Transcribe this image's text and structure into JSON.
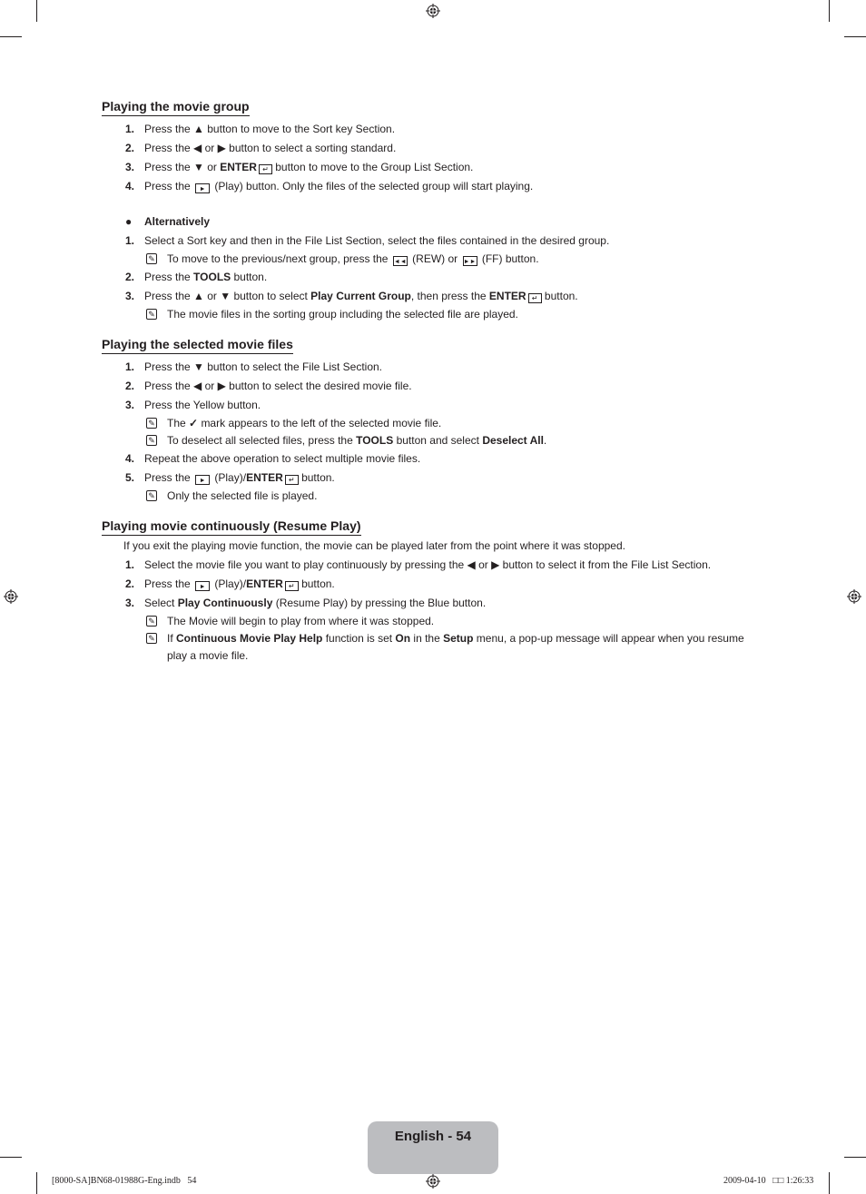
{
  "sections": [
    {
      "title": "Playing the movie group",
      "steps": [
        {
          "num": "1.",
          "parts": [
            "Press the ",
            "▲",
            " button to move to the Sort key Section."
          ]
        },
        {
          "num": "2.",
          "parts": [
            "Press the ",
            "◀ or ▶",
            " button to select a sorting standard."
          ]
        },
        {
          "num": "3.",
          "pre": "Press the ▼ or ",
          "bold": "ENTER",
          "post": " button to move to the Group List Section."
        },
        {
          "num": "4.",
          "pre": "Press the",
          "post": "(Play) button. Only the files of the selected group will start playing."
        }
      ],
      "alternatively": {
        "label": "Alternatively",
        "step1": {
          "num": "1.",
          "text": "Select a Sort key and then in the File List Section, select the files contained in the desired group."
        },
        "note1": {
          "pre": "To move to the previous/next group, press the",
          "mid": "(REW) or",
          "post": "(FF) button."
        },
        "step2": {
          "num": "2.",
          "pre": "Press the ",
          "bold": "TOOLS",
          "post": " button."
        },
        "step3": {
          "num": "3.",
          "pre": "Press the ▲ or ▼ button to select ",
          "bold1": "Play Current Group",
          "mid": ", then press the ",
          "bold2": "ENTER",
          "post": " button."
        },
        "note3": "The movie files in the sorting group including the selected file are played."
      }
    },
    {
      "title": "Playing the selected movie files",
      "step1": {
        "num": "1.",
        "text": "Press the ▼ button to select the File List Section."
      },
      "step2": {
        "num": "2.",
        "text": "Press the ◀ or ▶ button to select the desired movie file."
      },
      "step3": {
        "num": "3.",
        "text": "Press the Yellow button."
      },
      "note3a": {
        "pre": "The",
        "post": "mark appears to the left of the selected movie file."
      },
      "note3b": {
        "pre": "To deselect all selected files, press the ",
        "bold1": "TOOLS",
        "mid": " button and select ",
        "bold2": "Deselect All",
        "post": "."
      },
      "step4": {
        "num": "4.",
        "text": "Repeat the above operation to select multiple movie files."
      },
      "step5": {
        "num": "5.",
        "pre": "Press the",
        "mid": "(Play)/",
        "bold": "ENTER",
        "post": " button."
      },
      "note5": "Only the selected file is played."
    },
    {
      "title": "Playing movie continuously (Resume Play)",
      "intro": "If you exit the playing movie function, the movie can be played later from the point where it was stopped.",
      "step1": {
        "num": "1.",
        "text": "Select the movie file you want to play continuously by pressing the ◀ or ▶ button to select it from the File List Section."
      },
      "step2": {
        "num": "2.",
        "pre": "Press the",
        "mid": "(Play)/",
        "bold": "ENTER",
        "post": " button."
      },
      "step3": {
        "num": "3.",
        "pre": "Select ",
        "bold": "Play Continuously",
        "post": " (Resume Play) by pressing the Blue button."
      },
      "note3a": "The Movie will begin to play from where it was stopped.",
      "note3b": {
        "pre": "If ",
        "bold1": "Continuous Movie Play Help",
        "mid1": " function is set ",
        "bold2": "On",
        "mid2": " in the ",
        "bold3": "Setup",
        "post": " menu, a pop-up message will appear when you resume play a movie file."
      }
    }
  ],
  "icons": {
    "play": "►",
    "rew": "◄◄",
    "ff": "►►",
    "enter": "↵",
    "check": "✓",
    "note": "✎"
  },
  "page_label": "English - 54",
  "footer": {
    "left": "[8000-SA]BN68-01988G-Eng.indb   54",
    "right": "2009-04-10   □□ 1:26:33"
  }
}
